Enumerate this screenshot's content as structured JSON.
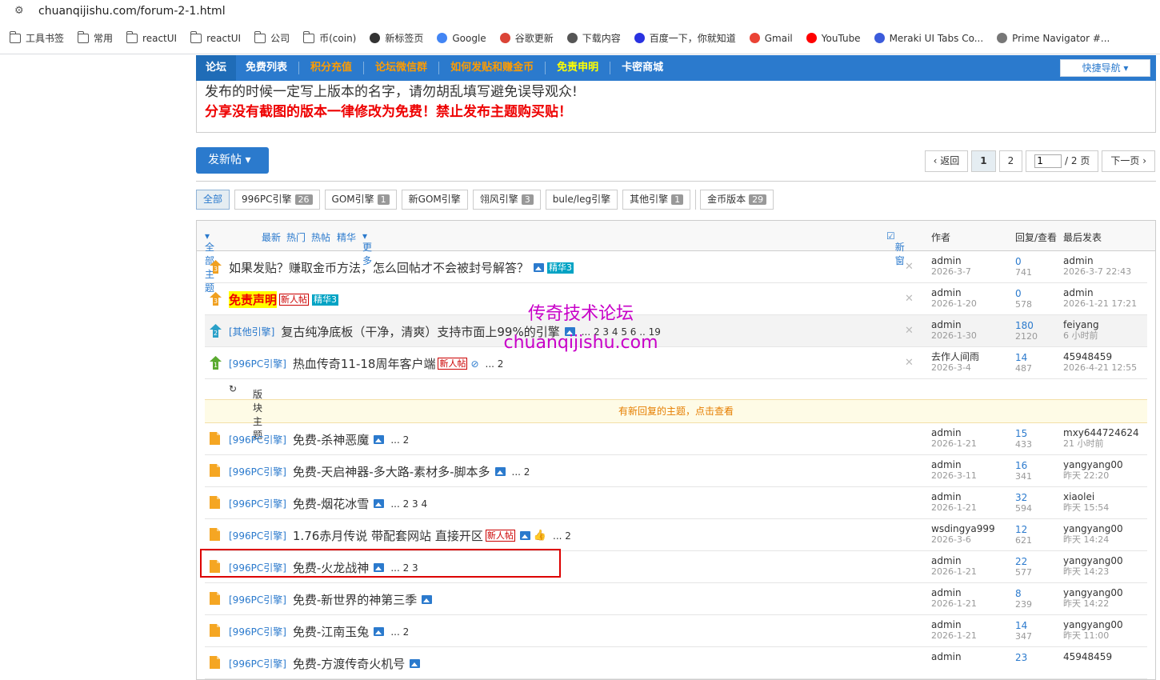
{
  "browser": {
    "url": "chuanqijishu.com/forum-2-1.html",
    "bookmarks": [
      {
        "label": "工具书签",
        "icon": "folder-icon"
      },
      {
        "label": "常用",
        "icon": "folder-icon"
      },
      {
        "label": "reactUI",
        "icon": "folder-icon"
      },
      {
        "label": "reactUI",
        "icon": "folder-icon"
      },
      {
        "label": "公司",
        "icon": "folder-icon"
      },
      {
        "label": "币(coin)",
        "icon": "folder-icon"
      },
      {
        "label": "新标签页",
        "icon": "github-icon"
      },
      {
        "label": "Google",
        "icon": "google-icon"
      },
      {
        "label": "谷歌更新",
        "icon": "chrome-icon"
      },
      {
        "label": "下载内容",
        "icon": "download-icon"
      },
      {
        "label": "百度一下，你就知道",
        "icon": "baidu-icon"
      },
      {
        "label": "Gmail",
        "icon": "gmail-icon"
      },
      {
        "label": "YouTube",
        "icon": "youtube-icon"
      },
      {
        "label": "Meraki UI Tabs Co...",
        "icon": "meraki-icon"
      },
      {
        "label": "Prime Navigator #...",
        "icon": "wordpress-icon"
      }
    ]
  },
  "nav": {
    "items": [
      "论坛",
      "免费列表",
      "积分充值",
      "论坛微信群",
      "如何发贴和赚金币",
      "免责申明",
      "卡密商城"
    ],
    "quick": "快捷导航"
  },
  "notice": {
    "line1": "发布的时候一定写上版本的名字，请勿胡乱填写避免误导观众!",
    "line2": "分享没有截图的版本一律修改为免费！禁止发布主题购买贴！"
  },
  "actions": {
    "post": "发新帖",
    "back": "返回",
    "page1": "1",
    "page2": "2",
    "page_input": "1",
    "total_pages": "/ 2 页",
    "next": "下一页"
  },
  "types": [
    {
      "label": "全部",
      "count": ""
    },
    {
      "label": "996PC引擎",
      "count": "26"
    },
    {
      "label": "GOM引擎",
      "count": "1"
    },
    {
      "label": "新GOM引擎",
      "count": ""
    },
    {
      "label": "翎风引擎",
      "count": "3"
    },
    {
      "label": "bule/leg引擎",
      "count": ""
    },
    {
      "label": "其他引擎",
      "count": "1"
    },
    {
      "label": "金币版本",
      "count": "29"
    }
  ],
  "list_header": {
    "all": "全部主题",
    "latest": "最新",
    "hot": "热门",
    "hotpost": "热帖",
    "essence": "精华",
    "more": "更多",
    "newwin": "新窗",
    "author": "作者",
    "reply_view": "回复/查看",
    "last_post": "最后发表"
  },
  "sticky": [
    {
      "level": "3",
      "cat": "",
      "title": "如果发贴？赚取金币方法，怎么回帖才不会被封号解答？",
      "pic": true,
      "new": false,
      "ess": "精华3",
      "pages": "",
      "author": "admin",
      "date": "2026-3-7",
      "replies": "0",
      "views": "741",
      "last_user": "admin",
      "last_time": "2026-3-7 22:43"
    },
    {
      "level": "3",
      "cat": "",
      "title": "免责声明",
      "pic": false,
      "new": true,
      "ess": "精华3",
      "pages": "",
      "author": "admin",
      "date": "2026-1-20",
      "replies": "0",
      "views": "578",
      "last_user": "admin",
      "last_time": "2026-1-21 17:21"
    },
    {
      "level": "2",
      "cat": "[其他引擎]",
      "title": "复古纯净底板（干净，清爽）支持市面上99%的引擎",
      "pic": true,
      "new": false,
      "ess": "",
      "pages": "... 2 3 4 5 6 .. 19",
      "author": "admin",
      "date": "2026-1-30",
      "replies": "180",
      "views": "2120",
      "last_user": "feiyang",
      "last_time": "6 小时前"
    },
    {
      "level": "1",
      "cat": "[996PC引擎]",
      "title": "热血传奇11-18周年客户端",
      "pic": false,
      "new": true,
      "ess": "",
      "pages": "... 2",
      "author": "去作人间雨",
      "date": "2026-3-4",
      "replies": "14",
      "views": "487",
      "last_user": "45948459",
      "last_time": "2026-4-21 12:55"
    }
  ],
  "section_label": "版块主题",
  "new_reply_notice": "有新回复的主题，点击查看",
  "threads": [
    {
      "cat": "[996PC引擎]",
      "title": "免费-杀神恶魔",
      "new": false,
      "pages": "... 2",
      "author": "admin",
      "date": "2026-1-21",
      "replies": "15",
      "views": "433",
      "last_user": "mxy644724624",
      "last_time": "21 小时前"
    },
    {
      "cat": "[996PC引擎]",
      "title": "免费-天启神器-多大路-素材多-脚本多",
      "new": false,
      "pages": "... 2",
      "author": "admin",
      "date": "2026-3-11",
      "replies": "16",
      "views": "341",
      "last_user": "yangyang00",
      "last_time": "昨天 22:20"
    },
    {
      "cat": "[996PC引擎]",
      "title": "免费-烟花冰雪",
      "new": false,
      "pages": "... 2 3 4",
      "author": "admin",
      "date": "2026-1-21",
      "replies": "32",
      "views": "594",
      "last_user": "xiaolei",
      "last_time": "昨天 15:54"
    },
    {
      "cat": "[996PC引擎]",
      "title": "1.76赤月传说 带配套网站 直接开区",
      "new": true,
      "pages": "... 2",
      "author": "wsdingya999",
      "date": "2026-3-6",
      "replies": "12",
      "views": "621",
      "last_user": "yangyang00",
      "last_time": "昨天 14:24"
    },
    {
      "cat": "[996PC引擎]",
      "title": "免费-火龙战神",
      "new": false,
      "pages": "... 2 3",
      "author": "admin",
      "date": "2026-1-21",
      "replies": "22",
      "views": "577",
      "last_user": "yangyang00",
      "last_time": "昨天 14:23"
    },
    {
      "cat": "[996PC引擎]",
      "title": "免费-新世界的神第三季",
      "new": false,
      "pages": "",
      "author": "admin",
      "date": "2026-1-21",
      "replies": "8",
      "views": "239",
      "last_user": "yangyang00",
      "last_time": "昨天 14:22"
    },
    {
      "cat": "[996PC引擎]",
      "title": "免费-江南玉兔",
      "new": false,
      "pages": "... 2",
      "author": "admin",
      "date": "2026-1-21",
      "replies": "14",
      "views": "347",
      "last_user": "yangyang00",
      "last_time": "昨天 11:00"
    },
    {
      "cat": "[996PC引擎]",
      "title": "免费-方渡传奇火机号",
      "new": false,
      "pages": "",
      "author": "admin",
      "date": "",
      "replies": "23",
      "views": "",
      "last_user": "45948459",
      "last_time": ""
    }
  ],
  "watermark": {
    "line1": "传奇技术论坛",
    "line2": "chuanqijishu.com"
  }
}
